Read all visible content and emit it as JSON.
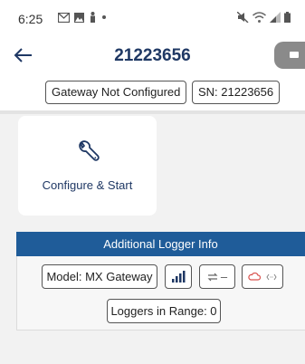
{
  "status_bar": {
    "time": "6:25",
    "icons_left": [
      "gmail-icon",
      "image-icon",
      "figure-icon",
      "dot-icon"
    ],
    "icons_right": [
      "mute-icon",
      "wifi-icon",
      "signal-icon",
      "battery-icon"
    ]
  },
  "header": {
    "title": "21223656",
    "back_icon": "back-arrow-icon"
  },
  "chips": {
    "status": "Gateway Not Configured",
    "serial": "SN: 21223656"
  },
  "configure_card": {
    "label": "Configure & Start",
    "icon": "wrench-icon"
  },
  "additional_info": {
    "title": "Additional Logger Info",
    "model": "Model: MX Gateway",
    "port_value": "–",
    "loggers_in_range": "Loggers in Range: 0"
  },
  "colors": {
    "primary_navy": "#1f3864",
    "section_header_blue": "#1f5c99",
    "cloud_red": "#d9534f",
    "background": "#f2f2f2"
  }
}
